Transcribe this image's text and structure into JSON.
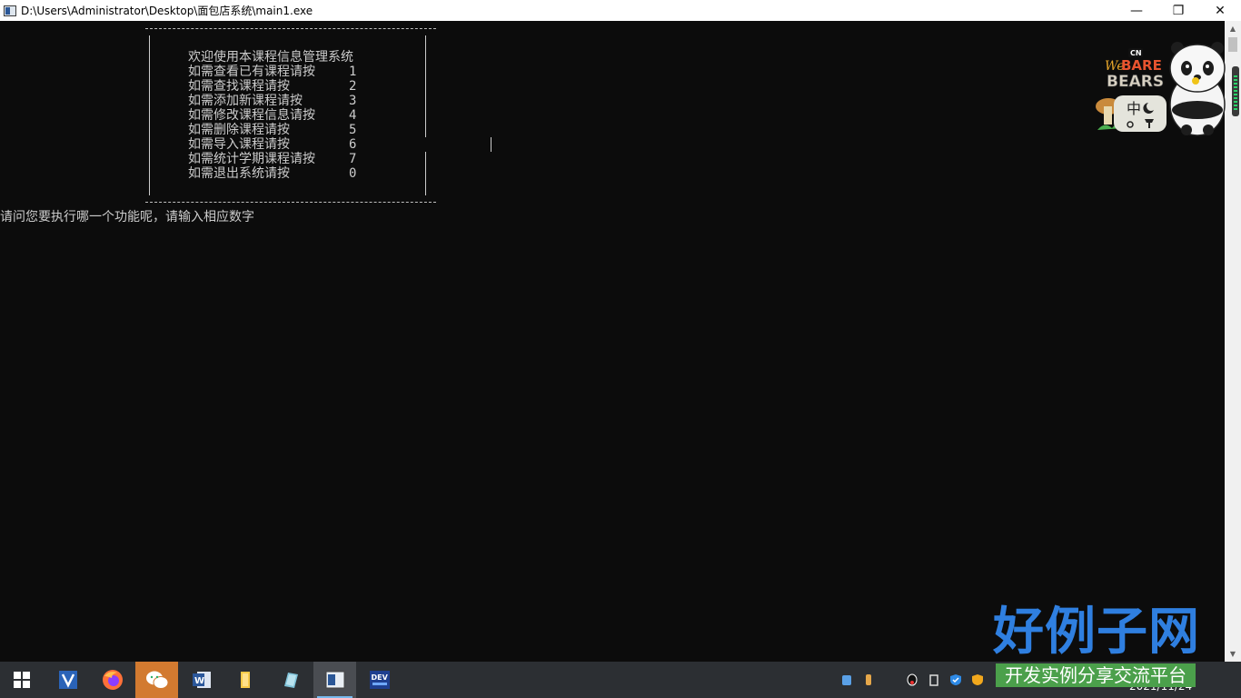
{
  "window": {
    "title": "D:\\Users\\Administrator\\Desktop\\面包店系统\\main1.exe",
    "minimize_glyph": "—",
    "maximize_glyph": "❐",
    "close_glyph": "✕"
  },
  "console": {
    "menu_title": "欢迎使用本课程信息管理系统",
    "menu_items": [
      {
        "label": "如需查看已有课程请按",
        "key": "1"
      },
      {
        "label": "如需查找课程请按",
        "key": "2"
      },
      {
        "label": "如需添加新课程请按",
        "key": "3"
      },
      {
        "label": "如需修改课程信息请按",
        "key": "4"
      },
      {
        "label": "如需删除课程请按",
        "key": "5"
      },
      {
        "label": "如需导入课程请按",
        "key": "6"
      },
      {
        "label": "如需统计学期课程请按",
        "key": "7"
      },
      {
        "label": "如需退出系统请按",
        "key": "0"
      }
    ],
    "prompt": "请问您要执行哪一个功能呢，请输入相应数字"
  },
  "widget": {
    "brand_cn": "CN",
    "brand_we": "We",
    "brand_bare": "BARE",
    "brand_bears": "BEARS",
    "ime_mode": "中"
  },
  "watermark": {
    "main": "好例子网",
    "sub": "开发实例分享交流平台"
  },
  "taskbar": {
    "apps": [
      {
        "name": "start",
        "icon": "windows-logo-icon"
      },
      {
        "name": "visual-studio",
        "icon": "vs-icon"
      },
      {
        "name": "firefox",
        "icon": "firefox-icon"
      },
      {
        "name": "wechat",
        "icon": "wechat-icon"
      },
      {
        "name": "word",
        "icon": "word-icon"
      },
      {
        "name": "file-explorer",
        "icon": "folder-icon"
      },
      {
        "name": "notepad",
        "icon": "notepad-icon"
      },
      {
        "name": "console",
        "icon": "console-icon"
      },
      {
        "name": "dev-cpp",
        "icon": "dev-cpp-icon"
      }
    ],
    "word_letter": "W",
    "dev_label": "DEV",
    "clock_date": "2021/11/24"
  },
  "colors": {
    "console_bg": "#0c0c0c",
    "console_text": "#cccccc",
    "watermark_blue": "#2f7fe0",
    "watermark_green": "#4ba04b",
    "taskbar": "#2c2f33"
  }
}
